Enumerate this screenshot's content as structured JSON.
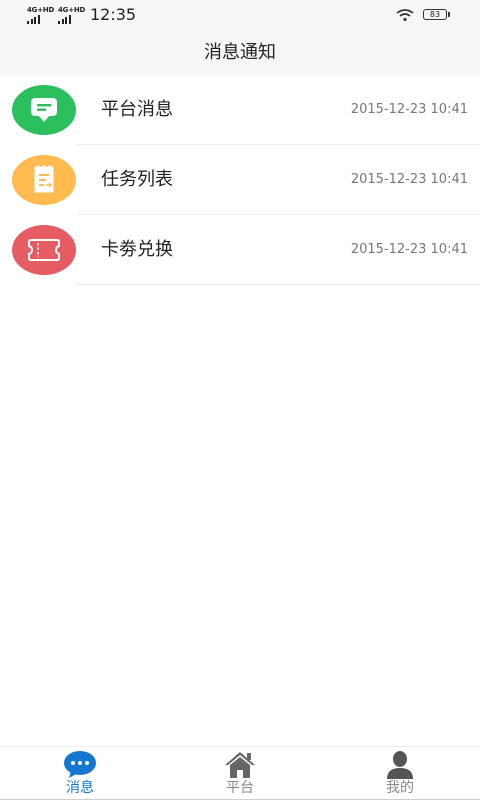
{
  "status_bar": {
    "network_1": "4G+HD",
    "network_2": "4G+HD",
    "time": "12:35",
    "battery": "83"
  },
  "header": {
    "title": "消息通知"
  },
  "list": {
    "items": [
      {
        "label": "平台消息",
        "time": "2015-12-23 10:41",
        "icon": "message-bubble-icon",
        "color": "#2cbf5e"
      },
      {
        "label": "任务列表",
        "time": "2015-12-23 10:41",
        "icon": "task-list-icon",
        "color": "#ffbb4e"
      },
      {
        "label": "卡劵兑换",
        "time": "2015-12-23 10:41",
        "icon": "ticket-icon",
        "color": "#e55c63"
      }
    ]
  },
  "bottom_nav": {
    "items": [
      {
        "label": "消息",
        "icon": "chat-bubble-icon",
        "active": true
      },
      {
        "label": "平台",
        "icon": "home-icon",
        "active": false
      },
      {
        "label": "我的",
        "icon": "user-icon",
        "active": false
      }
    ],
    "active_color": "#1677d2",
    "inactive_color": "#888888"
  }
}
